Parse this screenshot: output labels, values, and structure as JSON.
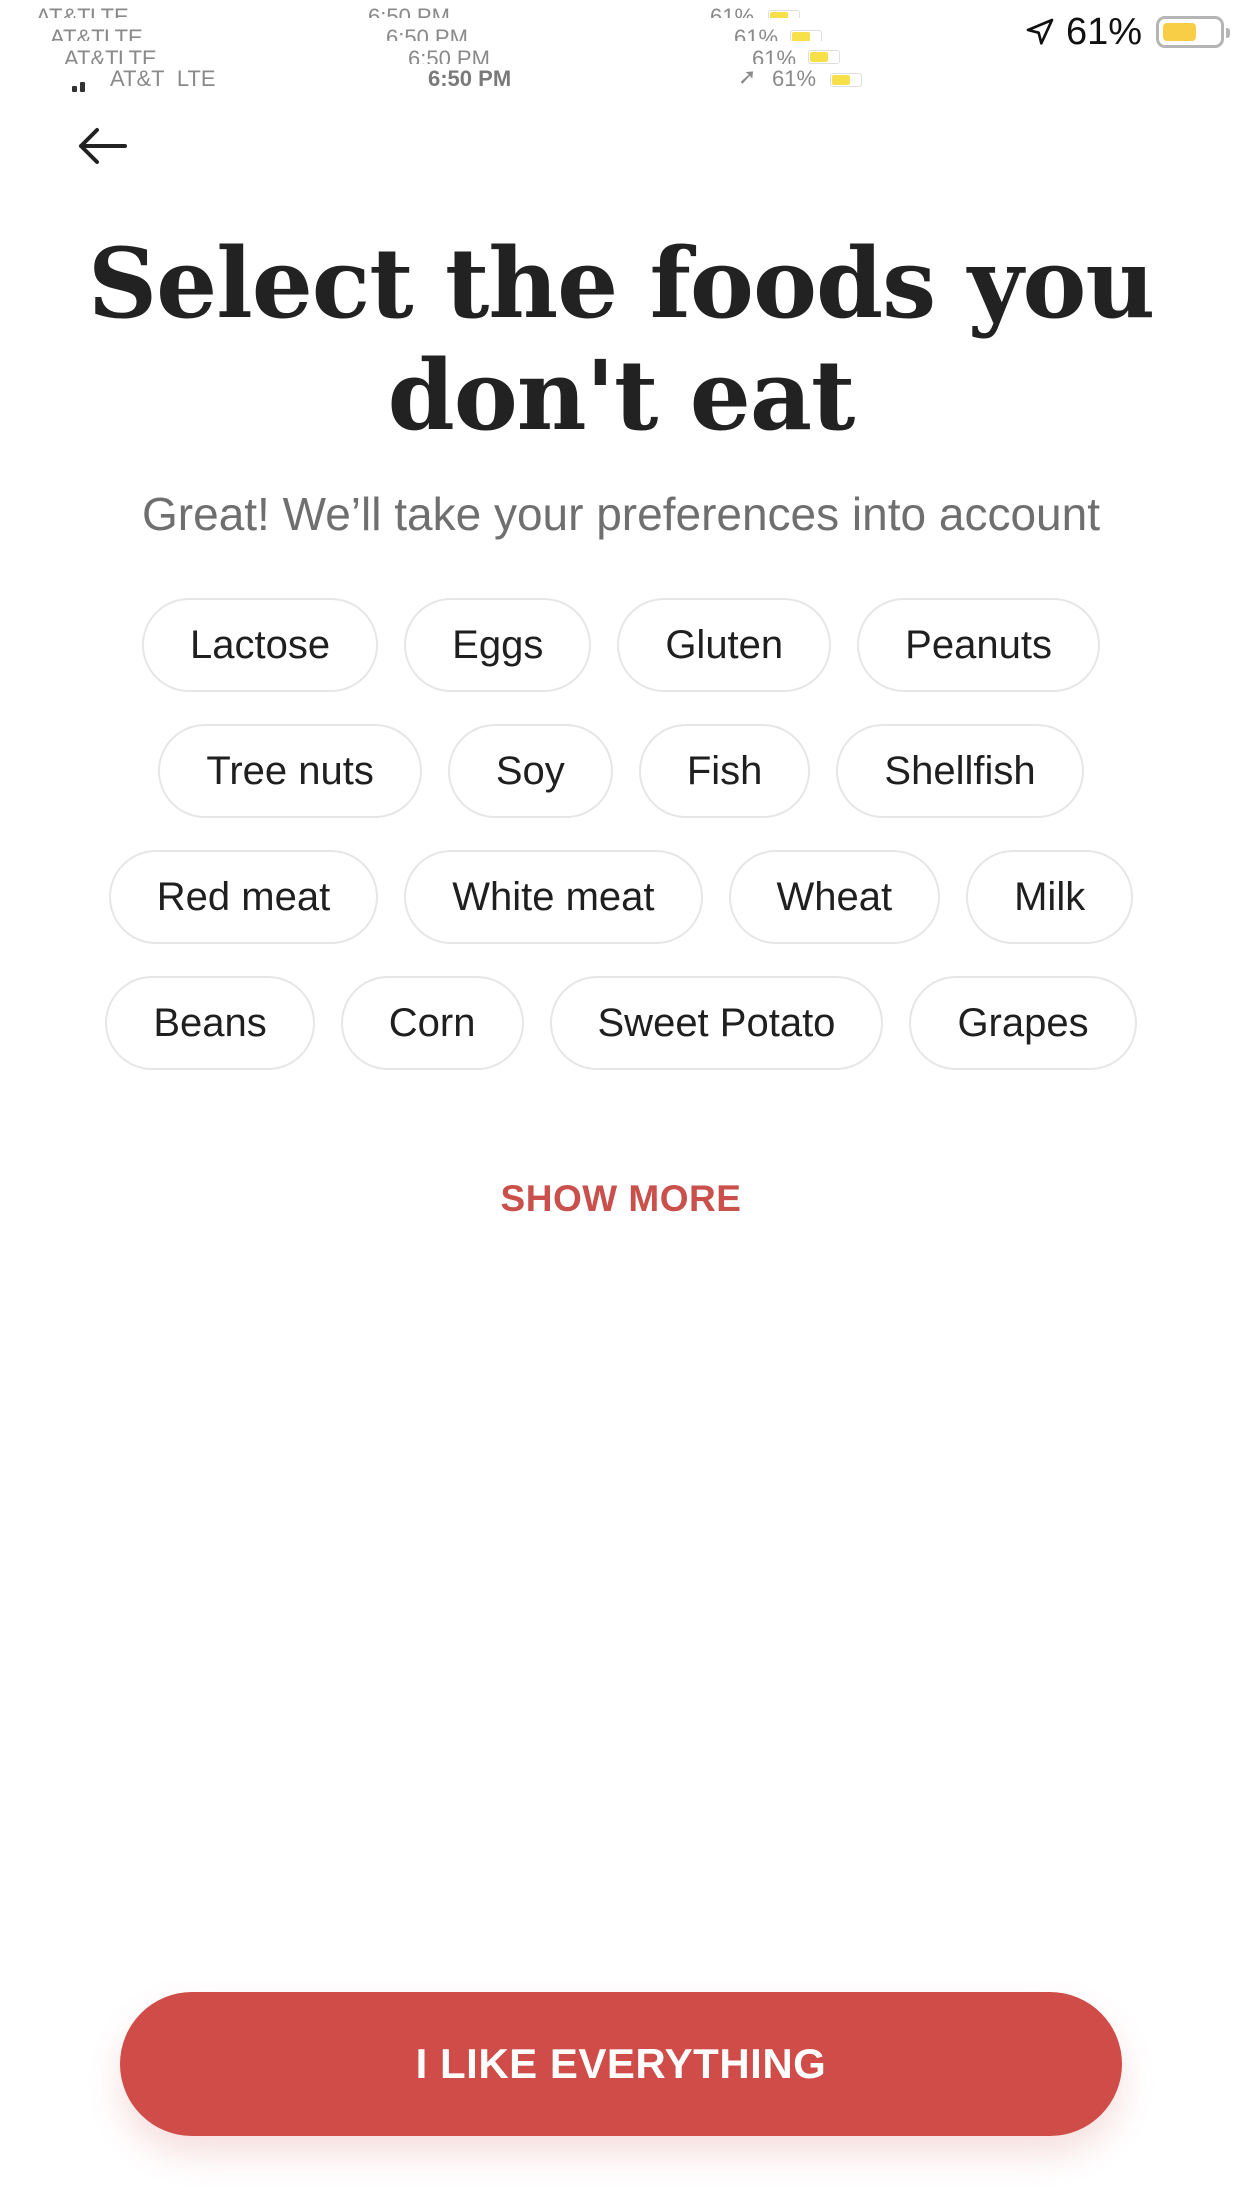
{
  "status_bar": {
    "carrier": "AT&T",
    "network": "LTE",
    "time": "6:50 PM",
    "battery_percent_text": "61%",
    "battery_level": 0.61,
    "battery_color": "#f7ce45"
  },
  "nav": {
    "back_icon": "arrow-left-icon"
  },
  "heading": {
    "title": "Select the foods you don't eat",
    "subtitle": "Great! We’ll take your preferences into account"
  },
  "food_chips": [
    [
      "Lactose",
      "Eggs",
      "Gluten",
      "Peanuts"
    ],
    [
      "Tree nuts",
      "Soy",
      "Fish",
      "Shellfish"
    ],
    [
      "Red meat",
      "White meat",
      "Wheat",
      "Milk"
    ],
    [
      "Beans",
      "Corn",
      "Sweet Potato",
      "Grapes"
    ]
  ],
  "show_more_label": "SHOW MORE",
  "cta_label": "I LIKE EVERYTHING",
  "colors": {
    "accent": "#cf4c48",
    "accent_text": "#c9504b",
    "chip_border": "#e6e6e6",
    "title": "#222222",
    "subtitle": "#6f6f6f"
  }
}
